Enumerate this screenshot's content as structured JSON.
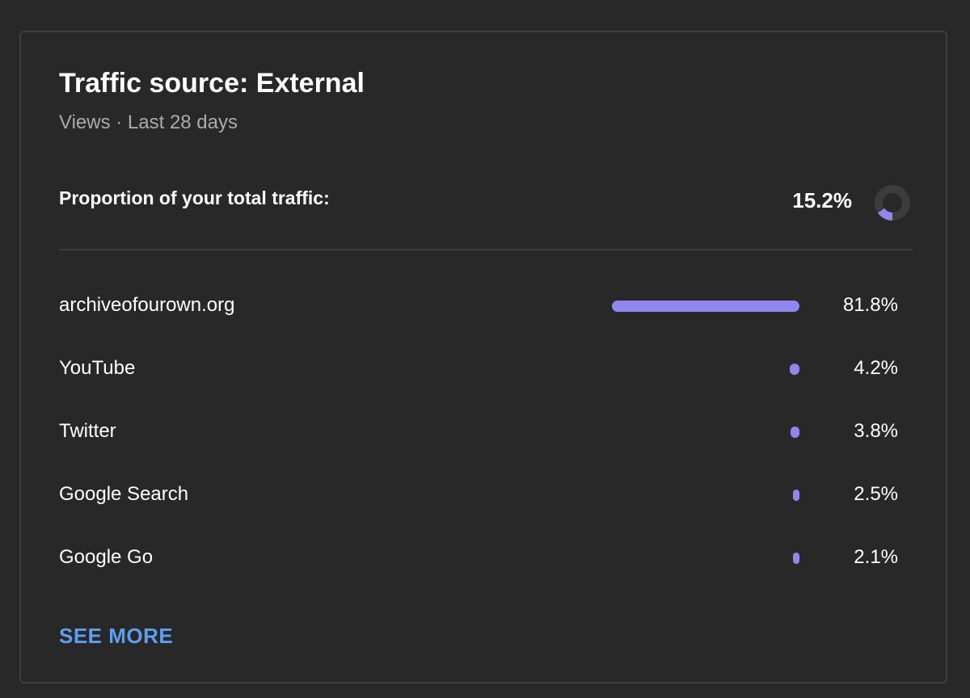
{
  "card": {
    "title": "Traffic source: External",
    "subtitle": "Views · Last 28 days",
    "proportion_label": "Proportion of your total traffic:",
    "proportion_value": "15.2%",
    "proportion_fraction": 0.152,
    "see_more_label": "SEE MORE"
  },
  "colors": {
    "accent": "#8f87ee",
    "link": "#5c9ff0",
    "donut_track": "#3c3c3c"
  },
  "sources": [
    {
      "label": "archiveofourown.org",
      "value": "81.8%",
      "percent": 81.8
    },
    {
      "label": "YouTube",
      "value": "4.2%",
      "percent": 4.2
    },
    {
      "label": "Twitter",
      "value": "3.8%",
      "percent": 3.8
    },
    {
      "label": "Google Search",
      "value": "2.5%",
      "percent": 2.5
    },
    {
      "label": "Google Go",
      "value": "2.1%",
      "percent": 2.1
    }
  ]
}
